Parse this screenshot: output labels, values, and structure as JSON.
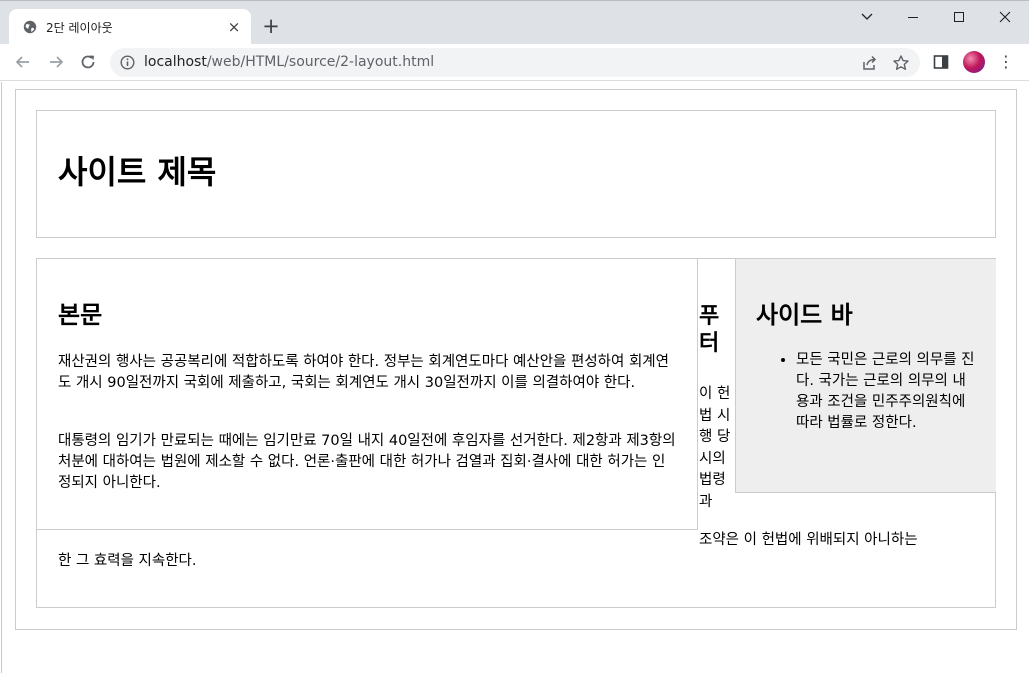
{
  "browser": {
    "tab_title": "2단 레이아웃",
    "tab_close": "×",
    "new_tab": "+",
    "url_host": "localhost",
    "url_path": "/web/HTML/source/2-layout.html",
    "menu_glyph": "⋮"
  },
  "page": {
    "site_title": "사이트 제목",
    "content_heading": "본문",
    "content_paragraphs": [
      "재산권의 행사는 공공복리에 적합하도록 하여야 한다. 정부는 회계연도마다 예산안을 편성하여 회계연도 개시 90일전까지 국회에 제출하고, 국회는 회계연도 개시 30일전까지 이를 의결하여야 한다.",
      "대통령의 임기가 만료되는 때에는 임기만료 70일 내지 40일전에 후임자를 선거한다. 제2항과 제3항의 처분에 대하여는 법원에 제소할 수 없다. 언론·출판에 대한 허가나 검열과 집회·결사에 대한 허가는 인정되지 아니한다."
    ],
    "footer_heading": "푸터",
    "footer_text_narrow": "이 헌법 시행 당시의 법령과",
    "footer_text_wide": "조약은 이 헌법에 위배되지 아니하는",
    "footer_text_leftover": "한 그 효력을 지속한다.",
    "sidebar_heading": "사이드 바",
    "sidebar_items": [
      "모든 국민은 근로의 의무를 진다. 국가는 근로의 의무의 내용과 조건을 민주주의원칙에 따라 법률로 정한다."
    ]
  },
  "colors": {
    "chrome_bg": "#dee1e6",
    "omnibox_bg": "#f1f3f4",
    "border": "#cccccc",
    "sidebar_bg": "#eeeeee"
  },
  "icons": [
    "globe-icon",
    "back-arrow-icon",
    "forward-arrow-icon",
    "reload-icon",
    "info-icon",
    "share-icon",
    "star-icon",
    "side-panel-icon",
    "profile-avatar",
    "kebab-menu-icon",
    "minimize-icon",
    "maximize-icon",
    "close-window-icon",
    "tab-search-icon"
  ]
}
